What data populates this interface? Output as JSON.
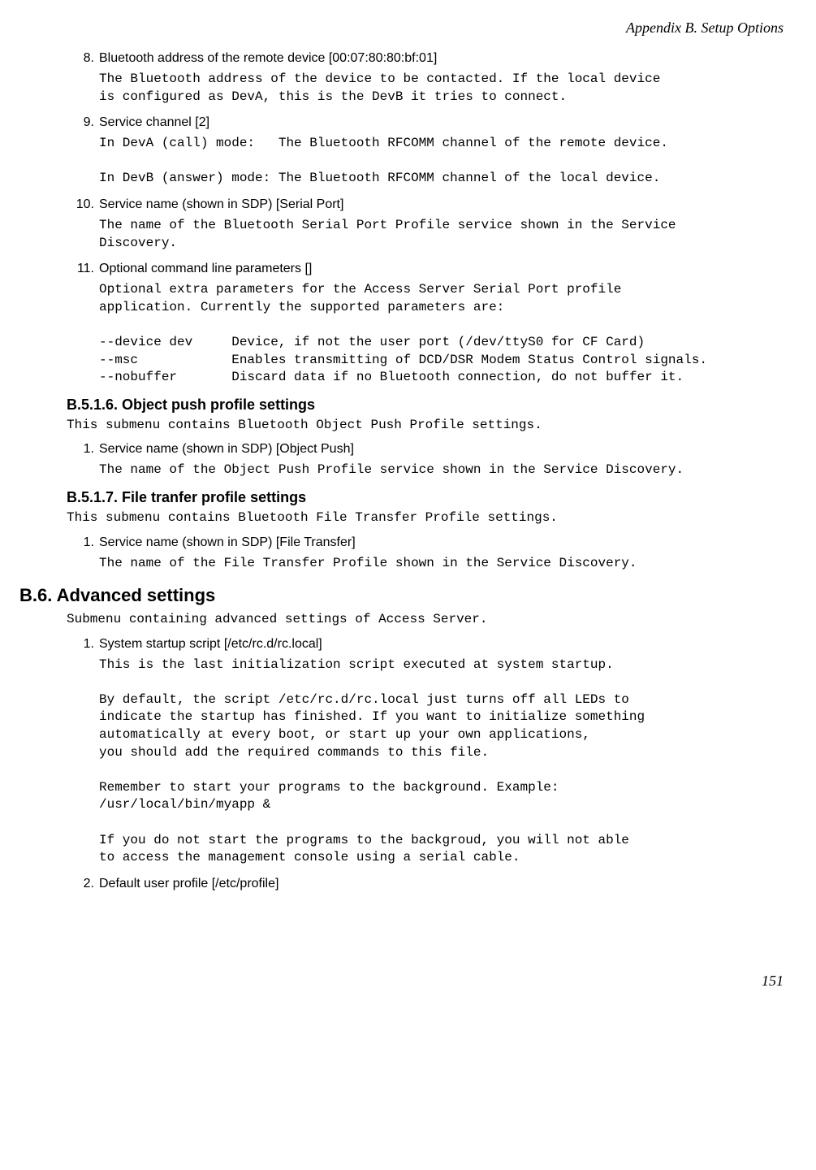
{
  "header": "Appendix B. Setup Options",
  "items_top": [
    {
      "num": "8.",
      "label": "Bluetooth address of the remote device [00:07:80:80:bf:01]",
      "body": "The Bluetooth address of the device to be contacted. If the local device\nis configured as DevA, this is the DevB it tries to connect."
    },
    {
      "num": "9.",
      "label": "Service channel [2]",
      "body": "In DevA (call) mode:   The Bluetooth RFCOMM channel of the remote device.\n\nIn DevB (answer) mode: The Bluetooth RFCOMM channel of the local device."
    },
    {
      "num": "10.",
      "label": "Service name (shown in SDP) [Serial Port]",
      "body": "The name of the Bluetooth Serial Port Profile service shown in the Service\nDiscovery."
    },
    {
      "num": "11.",
      "label": "Optional command line parameters []",
      "body": "Optional extra parameters for the Access Server Serial Port profile\napplication. Currently the supported parameters are:\n\n--device dev     Device, if not the user port (/dev/ttyS0 for CF Card)\n--msc            Enables transmitting of DCD/DSR Modem Status Control signals.\n--nobuffer       Discard data if no Bluetooth connection, do not buffer it."
    }
  ],
  "sec_b516": {
    "heading": "B.5.1.6. Object push profile settings",
    "intro": "This submenu contains Bluetooth Object Push Profile settings.",
    "items": [
      {
        "num": "1.",
        "label": "Service name (shown in SDP) [Object Push]",
        "body": "The name of the Object Push Profile service shown in the Service Discovery."
      }
    ]
  },
  "sec_b517": {
    "heading": "B.5.1.7. File tranfer profile settings",
    "intro": "This submenu contains Bluetooth File Transfer Profile settings.",
    "items": [
      {
        "num": "1.",
        "label": "Service name (shown in SDP) [File Transfer]",
        "body": "The name of the File Transfer Profile shown in the Service Discovery."
      }
    ]
  },
  "sec_b6": {
    "heading": "B.6. Advanced settings",
    "intro": "Submenu containing advanced settings of Access Server.",
    "items": [
      {
        "num": "1.",
        "label": "System startup script [/etc/rc.d/rc.local]",
        "body": "This is the last initialization script executed at system startup.\n\nBy default, the script /etc/rc.d/rc.local just turns off all LEDs to\nindicate the startup has finished. If you want to initialize something\nautomatically at every boot, or start up your own applications,\nyou should add the required commands to this file.\n\nRemember to start your programs to the background. Example:\n/usr/local/bin/myapp &\n\nIf you do not start the programs to the backgroud, you will not able\nto access the management console using a serial cable."
      },
      {
        "num": "2.",
        "label": "Default user profile [/etc/profile]",
        "body": ""
      }
    ]
  },
  "page_num": "151"
}
